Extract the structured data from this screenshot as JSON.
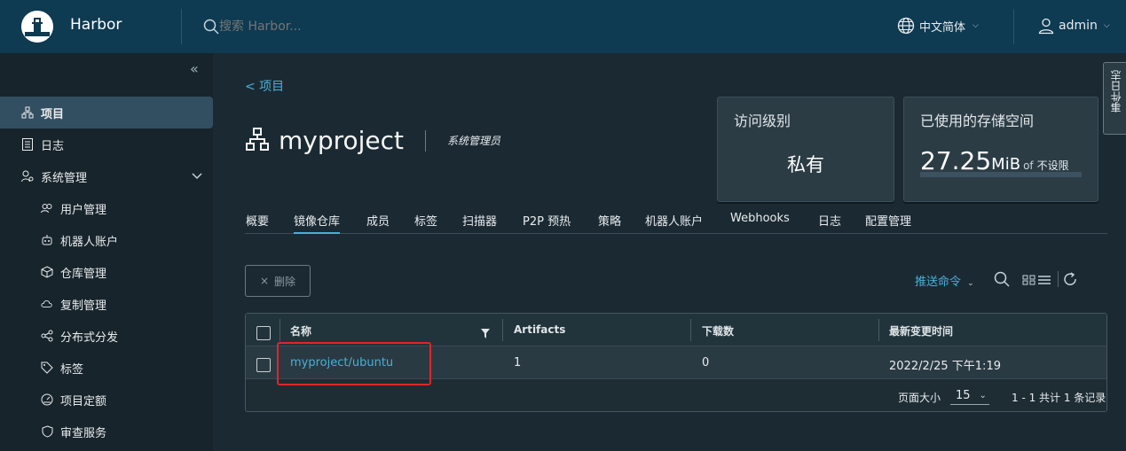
{
  "header": {
    "brand": "Harbor",
    "search_placeholder": "搜索 Harbor...",
    "language": "中文简体",
    "user": "admin"
  },
  "sidebar": {
    "items": [
      {
        "label": "项目",
        "icon": "projects-icon"
      },
      {
        "label": "日志",
        "icon": "logs-icon"
      },
      {
        "label": "系统管理",
        "icon": "admin-icon"
      },
      {
        "label": "用户管理",
        "icon": "users-icon"
      },
      {
        "label": "机器人账户",
        "icon": "robot-icon"
      },
      {
        "label": "仓库管理",
        "icon": "registry-icon"
      },
      {
        "label": "复制管理",
        "icon": "cloud-icon"
      },
      {
        "label": "分布式分发",
        "icon": "share-icon"
      },
      {
        "label": "标签",
        "icon": "tag-icon"
      },
      {
        "label": "项目定额",
        "icon": "quota-icon"
      },
      {
        "label": "审查服务",
        "icon": "shield-icon"
      }
    ]
  },
  "main": {
    "back_label": "< 项目",
    "project_name": "myproject",
    "role": "系统管理员",
    "access_card": {
      "title": "访问级别",
      "value": "私有"
    },
    "storage_card": {
      "title": "已使用的存储空间",
      "value": "27.25",
      "unit": "MiB",
      "of": "of",
      "limit": "不设限",
      "usage_fraction": 0
    },
    "tabs": [
      "概要",
      "镜像仓库",
      "成员",
      "标签",
      "扫描器",
      "P2P 预热",
      "策略",
      "机器人账户",
      "Webhooks",
      "日志",
      "配置管理"
    ],
    "active_tab": "镜像仓库",
    "delete_label": "删除",
    "push_command_label": "推送命令",
    "grid": {
      "columns": [
        "名称",
        "Artifacts",
        "下载数",
        "最新变更时间"
      ],
      "rows": [
        {
          "name": "myproject/ubuntu",
          "artifacts": "1",
          "pulls": "0",
          "updated": "2022/2/25 下午1:19"
        }
      ],
      "page_size_label": "页面大小",
      "page_size": "15",
      "summary": "1 - 1 共计 1 条记录"
    }
  },
  "event_tab_label": "事件日志",
  "colors": {
    "accent": "#49afd9",
    "header": "#0e3a52",
    "highlight": "#e0252b"
  }
}
